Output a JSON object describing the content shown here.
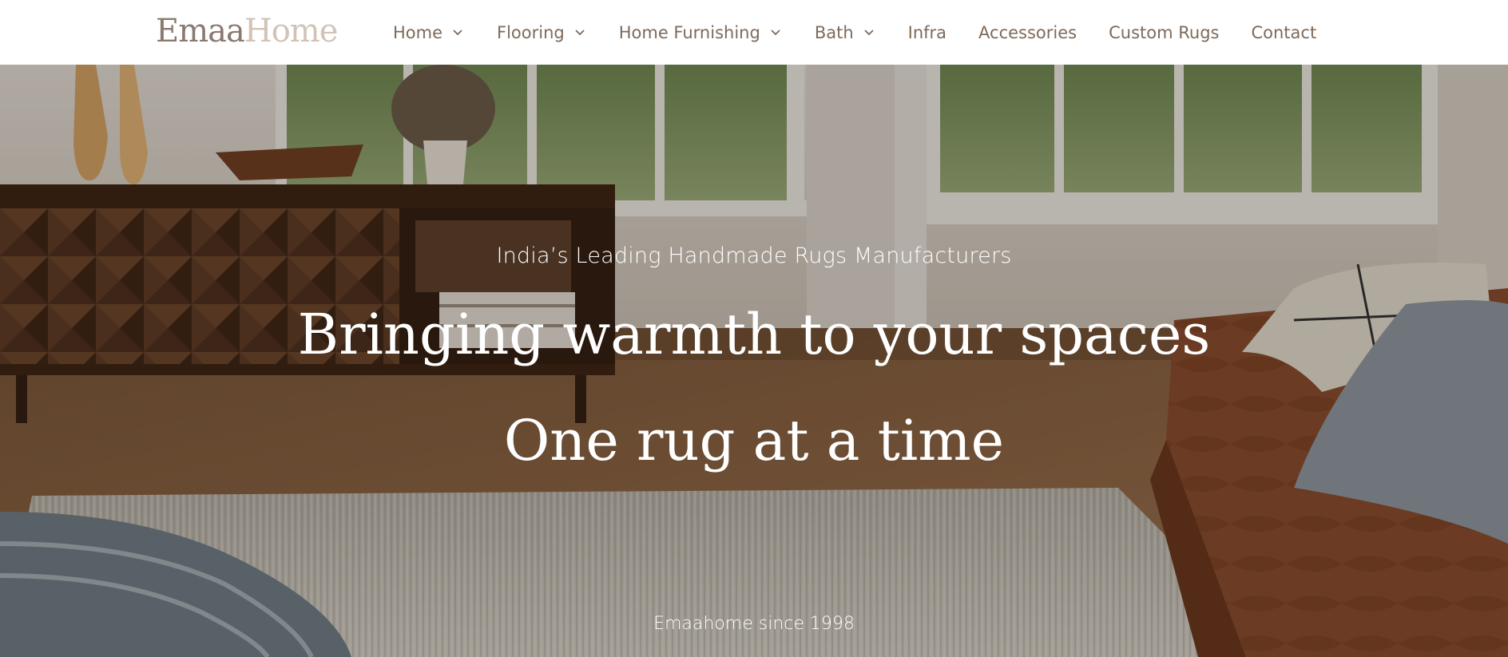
{
  "header": {
    "logo_part1": "Emaa",
    "logo_part2": "Home",
    "nav": [
      {
        "label": "Home",
        "has_dropdown": true
      },
      {
        "label": "Flooring",
        "has_dropdown": true
      },
      {
        "label": "Home Furnishing",
        "has_dropdown": true
      },
      {
        "label": "Bath",
        "has_dropdown": true
      },
      {
        "label": "Infra",
        "has_dropdown": false
      },
      {
        "label": "Accessories",
        "has_dropdown": false
      },
      {
        "label": "Custom Rugs",
        "has_dropdown": false
      },
      {
        "label": "Contact",
        "has_dropdown": false
      }
    ]
  },
  "hero": {
    "subtitle": "India’s Leading Handmade Rugs Manufacturers",
    "headline_line1": "Bringing warmth to your spaces",
    "headline_line2": "One rug at a time",
    "since": "Emaahome since 1998"
  },
  "colors": {
    "nav_text": "#7e6a5a",
    "logo_dark": "#8a7a70",
    "logo_light": "#d2c3b6",
    "hero_text": "#ffffff"
  }
}
